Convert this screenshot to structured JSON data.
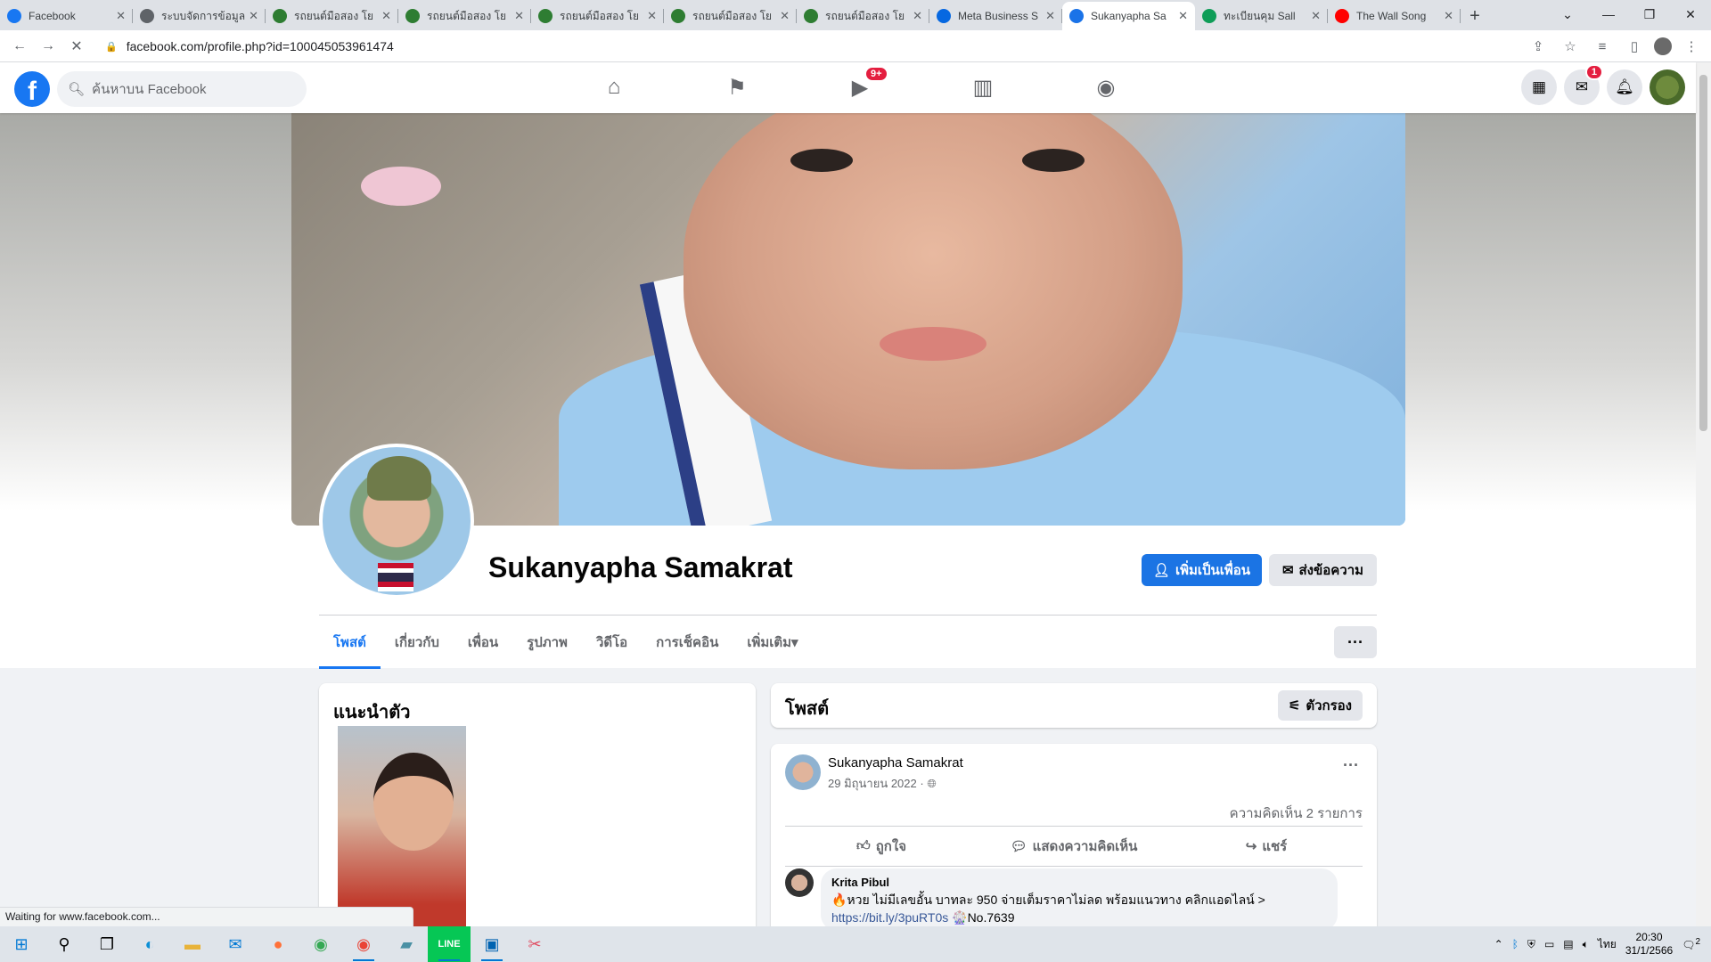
{
  "browser": {
    "tabs": [
      {
        "title": "Facebook",
        "icon": "facebook-favicon",
        "color": "#1877f2"
      },
      {
        "title": "ระบบจัดการข้อมูล",
        "icon": "globe-favicon",
        "color": "#5f6368"
      },
      {
        "title": "รถยนต์มือสอง โย",
        "icon": "car-favicon",
        "color": "#2e7d32"
      },
      {
        "title": "รถยนต์มือสอง โย",
        "icon": "car-favicon",
        "color": "#2e7d32"
      },
      {
        "title": "รถยนต์มือสอง โย",
        "icon": "car-favicon",
        "color": "#2e7d32"
      },
      {
        "title": "รถยนต์มือสอง โย",
        "icon": "car-favicon",
        "color": "#2e7d32"
      },
      {
        "title": "รถยนต์มือสอง โย",
        "icon": "car-favicon",
        "color": "#2e7d32"
      },
      {
        "title": "Meta Business S",
        "icon": "meta-favicon",
        "color": "#0668e1"
      },
      {
        "title": "Sukanyapha Sa",
        "icon": "loading-favicon",
        "color": "#1a73e8",
        "active": true
      },
      {
        "title": "ทะเบียนคุม Sall",
        "icon": "sheets-favicon",
        "color": "#0f9d58"
      },
      {
        "title": "The Wall Song",
        "icon": "youtube-favicon",
        "color": "#ff0000"
      }
    ],
    "url": "facebook.com/profile.php?id=100045053961474",
    "status": "Waiting for www.facebook.com..."
  },
  "facebook": {
    "search_placeholder": "ค้นหาบน Facebook",
    "watch_badge": "9+",
    "messenger_badge": "1",
    "brand_color": "#1877f2"
  },
  "profile": {
    "name": "Sukanyapha Samakrat",
    "add_friend": "เพิ่มเป็นเพื่อน",
    "send_message": "ส่งข้อความ",
    "tabs": [
      "โพสต์",
      "เกี่ยวกับ",
      "เพื่อน",
      "รูปภาพ",
      "วิดีโอ",
      "การเช็คอิน",
      "เพิ่มเติม"
    ]
  },
  "intro": {
    "title": "แนะนำตัว"
  },
  "posts": {
    "title": "โพสต์",
    "filter": "ตัวกรอง",
    "post": {
      "author": "Sukanyapha Samakrat",
      "date": "29 มิถุนายน 2022 ·",
      "comments_count": "ความคิดเห็น 2 รายการ",
      "like": "ถูกใจ",
      "comment": "แสดงความคิดเห็น",
      "share": "แชร์",
      "first_comment": {
        "author": "Krita Pibul",
        "text": "🔥หวย ไม่มีเลขอั้น บาทละ 950 จ่ายเต็มราคาไม่ลด พร้อมแนวทาง คลิกแอดไลน์ >",
        "link": "https://bit.ly/3puRT0s",
        "suffix": "🎡No.7639"
      }
    }
  },
  "taskbar": {
    "lang": "ไทย",
    "time": "20:30",
    "date": "31/1/2566",
    "notif": "2"
  }
}
